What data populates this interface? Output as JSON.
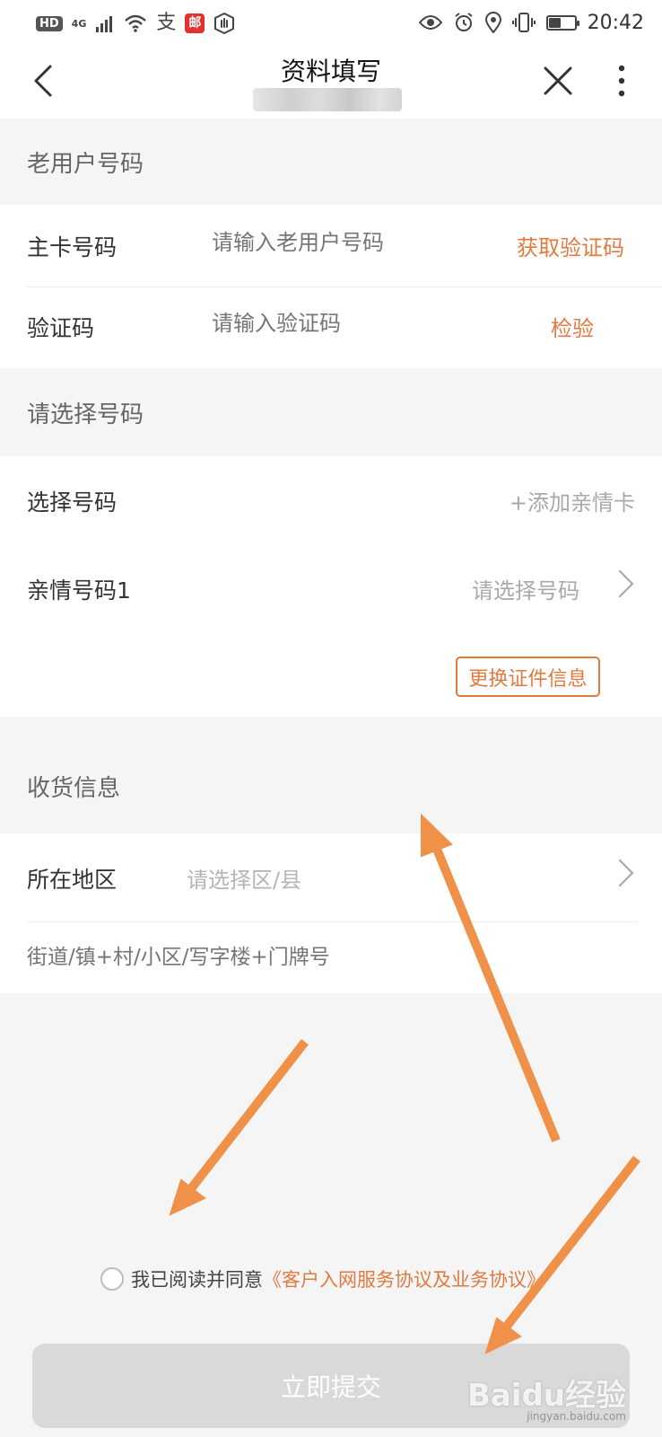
{
  "status_bar": {
    "hd": "HD",
    "network": "4G",
    "alipay_glyph": "支",
    "post_glyph": "邮",
    "time": "20:42",
    "battery_level": 0.45,
    "icons": [
      "signal-icon",
      "wifi-icon",
      "alipay-icon",
      "post-icon",
      "hand-icon",
      "eye-icon",
      "alarm-icon",
      "location-icon",
      "vibrate-icon",
      "battery-icon"
    ]
  },
  "nav": {
    "title": "资料填写",
    "icons": [
      "back-arrow-icon",
      "close-icon",
      "more-icon"
    ]
  },
  "old_user": {
    "header": "老用户号码",
    "main_card_label": "主卡号码",
    "main_card_placeholder": "请输入老用户号码",
    "get_code_label": "获取验证码",
    "code_label": "验证码",
    "code_placeholder": "请输入验证码",
    "verify_label": "检验"
  },
  "number_select": {
    "header": "请选择号码",
    "select_label": "选择号码",
    "add_family_card": "+添加亲情卡",
    "family_number_label": "亲情号码1",
    "family_number_placeholder": "请选择号码",
    "change_id_button": "更换证件信息"
  },
  "shipping": {
    "header": "收货信息",
    "region_label": "所在地区",
    "region_placeholder": "请选择区/县",
    "street_placeholder": "街道/镇+村/小区/写字楼+门牌号"
  },
  "agreement": {
    "text": "我已阅读并同意",
    "link": "《客户入网服务协议及业务协议》"
  },
  "submit": {
    "label": "立即提交"
  },
  "watermark": {
    "brand": "Baidu经验",
    "url": "jingyan.baidu.com"
  },
  "colors": {
    "accent": "#e27a3f",
    "arrow": "#f0914a",
    "disabled_button": "#d9d9d9",
    "background": "#f5f5f5"
  }
}
